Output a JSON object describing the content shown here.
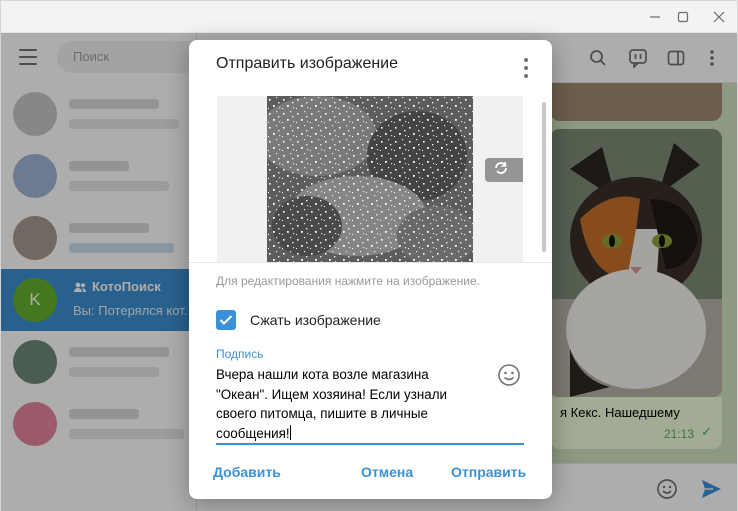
{
  "search": {
    "placeholder": "Поиск"
  },
  "chat_list": {
    "active": {
      "avatar_letter": "K",
      "name": "КотоПоиск",
      "snippet": "Вы: Потерялся кот."
    }
  },
  "chat": {
    "caption": "я Кекс. Нашедшему",
    "time": "21:13"
  },
  "dialog": {
    "title": "Отправить изображение",
    "hint": "Для редактирования нажмите на изображение.",
    "compress_label": "Сжать изображение",
    "compress_checked": true,
    "caption_label": "Подпись",
    "caption_lines": [
      "Вчера нашли кота возле магазина",
      "\"Океан\". Ищем хозяина! Если узнали",
      "своего питомца, пишите в личные",
      "сообщения!"
    ],
    "add_button": "Добавить",
    "cancel_button": "Отмена",
    "send_button": "Отправить"
  },
  "colors": {
    "accent": "#3b91d8",
    "active_chat": "#3b8fd0",
    "avatar": "#66b032",
    "outgoing_bubble": "#effdde"
  },
  "icons": [
    "hamburger-icon",
    "search-icon",
    "mentions-icon",
    "sidebar-toggle-icon",
    "more-vert-icon",
    "rotate-icon",
    "trash-icon",
    "checkbox-checked-icon",
    "emoji-icon",
    "send-icon",
    "group-icon",
    "minimize-icon",
    "maximize-icon",
    "close-icon"
  ]
}
